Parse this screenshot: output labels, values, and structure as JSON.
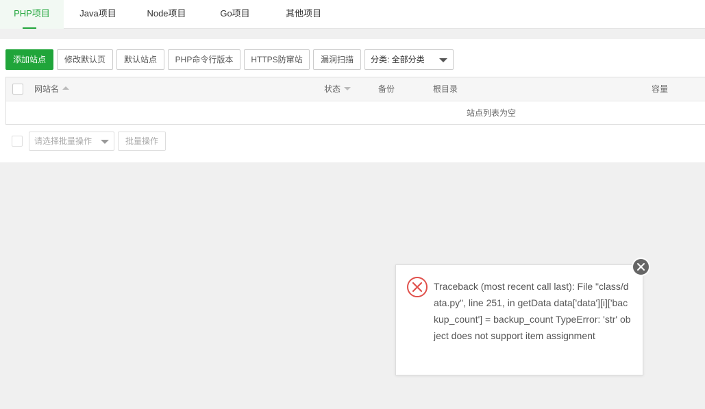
{
  "tabs": [
    {
      "label": "PHP项目",
      "active": true
    },
    {
      "label": "Java项目",
      "active": false
    },
    {
      "label": "Node项目",
      "active": false
    },
    {
      "label": "Go项目",
      "active": false
    },
    {
      "label": "其他项目",
      "active": false
    }
  ],
  "toolbar": {
    "add_site": "添加站点",
    "edit_default_page": "修改默认页",
    "default_site": "默认站点",
    "php_cli_version": "PHP命令行版本",
    "https_protection": "HTTPS防窜站",
    "vuln_scan": "漏洞扫描",
    "category_select": "分类: 全部分类"
  },
  "table": {
    "columns": {
      "site_name": "网站名",
      "status": "状态",
      "backup": "备份",
      "root_dir": "根目录",
      "capacity": "容量"
    },
    "empty_text": "站点列表为空"
  },
  "batch": {
    "select_placeholder": "请选择批量操作",
    "button": "批量操作"
  },
  "error_dialog": {
    "message": "Traceback (most recent call last): File \"class/data.py\", line 251, in getData data['data'][i]['backup_count'] = backup_count TypeError: 'str' object does not support item assignment"
  },
  "colors": {
    "accent": "#20a53a",
    "error": "#e0504b"
  }
}
